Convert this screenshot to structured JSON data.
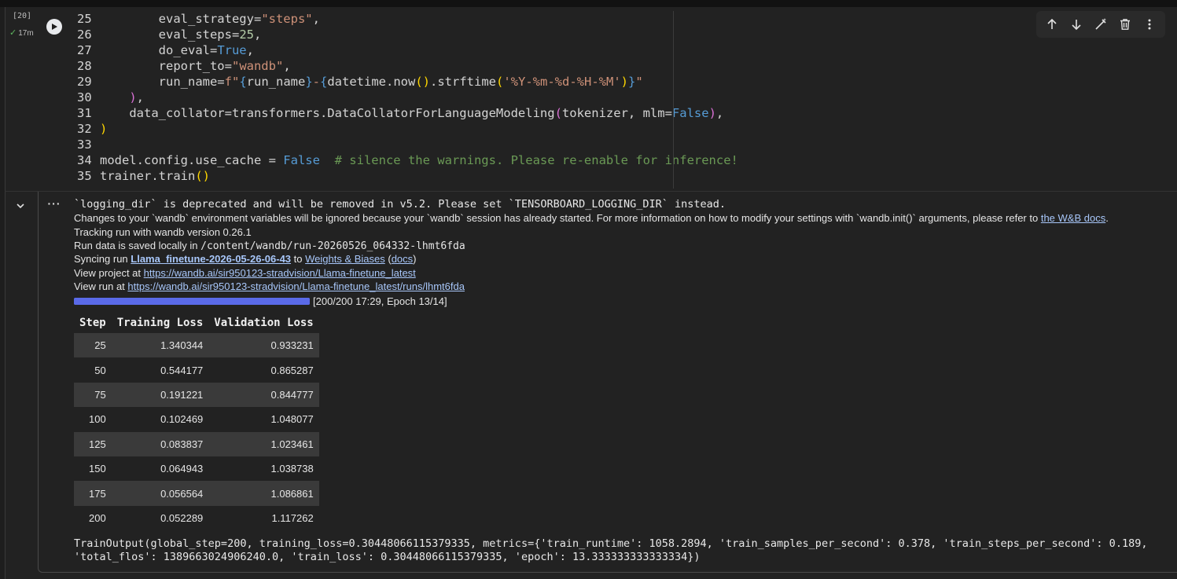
{
  "cell": {
    "exec_count": "[20]",
    "exec_time": "17m",
    "code_lines": [
      {
        "num": "25",
        "html": "        eval_strategy=<span class=\"s\">\"steps\"</span>,"
      },
      {
        "num": "26",
        "html": "        eval_steps=<span class=\"n\">25</span>,"
      },
      {
        "num": "27",
        "html": "        do_eval=<span class=\"k\">True</span>,"
      },
      {
        "num": "28",
        "html": "        report_to=<span class=\"s\">\"wandb\"</span>,"
      },
      {
        "num": "29",
        "html": "        run_name=<span class=\"s\">f\"</span><span class=\"k\">{</span>run_name<span class=\"k\">}</span><span class=\"s\">-</span><span class=\"k\">{</span>datetime.now<span class=\"p1\">()</span>.strftime<span class=\"p1\">(</span><span class=\"s\">'%Y-%m-%d-%H-%M'</span><span class=\"p1\">)</span><span class=\"k\">}</span><span class=\"s\">\"</span>"
      },
      {
        "num": "30",
        "html": "    <span class=\"p2\">)</span>,"
      },
      {
        "num": "31",
        "html": "    data_collator=transformers.DataCollatorForLanguageModeling<span class=\"p2\">(</span>tokenizer, mlm=<span class=\"k\">False</span><span class=\"p2\">)</span>,"
      },
      {
        "num": "32",
        "html": "<span class=\"p1\">)</span>"
      },
      {
        "num": "33",
        "html": ""
      },
      {
        "num": "34",
        "html": "model.config.use_cache = <span class=\"k\">False</span>  <span class=\"c\"># silence the warnings. Please re-enable for inference!</span>"
      },
      {
        "num": "35",
        "html": "trainer.train<span class=\"p1\">()</span>"
      }
    ]
  },
  "output": {
    "warning": "`logging_dir` is deprecated and will be removed in v5.2. Please set `TENSORBOARD_LOGGING_DIR` instead.",
    "env_notice": "Changes to your `wandb` environment variables will be ignored because your `wandb` session has already started. For more information on how to modify your settings with `wandb.init()` arguments, please refer to ",
    "env_link": "the W&B docs",
    "env_end": ".",
    "tracking": "Tracking run with wandb version 0.26.1",
    "run_saved_prefix": "Run data is saved locally in ",
    "run_saved_path": "/content/wandb/run-20260526_064332-lhmt6fda",
    "sync_prefix": "Syncing run ",
    "sync_run": "Llama_finetune-2026-05-26-06-43",
    "sync_to": " to ",
    "sync_wb": "Weights & Biases",
    "sync_open": " (",
    "sync_docs": "docs",
    "sync_close": ")",
    "project_prefix": "View project at ",
    "project_url": "https://wandb.ai/sir950123-stradvision/Llama-finetune_latest",
    "run_prefix": "View run at ",
    "run_url": "https://wandb.ai/sir950123-stradvision/Llama-finetune_latest/runs/lhmt6fda",
    "progress_fraction": 1.0,
    "progress_text": "[200/200 17:29, Epoch 13/14]",
    "table": {
      "headers": [
        "Step",
        "Training Loss",
        "Validation Loss"
      ],
      "rows": [
        [
          "25",
          "1.340344",
          "0.933231"
        ],
        [
          "50",
          "0.544177",
          "0.865287"
        ],
        [
          "75",
          "0.191221",
          "0.844777"
        ],
        [
          "100",
          "0.102469",
          "1.048077"
        ],
        [
          "125",
          "0.083837",
          "1.023461"
        ],
        [
          "150",
          "0.064943",
          "1.038738"
        ],
        [
          "175",
          "0.056564",
          "1.086861"
        ],
        [
          "200",
          "0.052289",
          "1.117262"
        ]
      ]
    },
    "train_output": "TrainOutput(global_step=200, training_loss=0.30448066115379335, metrics={'train_runtime': 1058.2894, 'train_samples_per_second': 0.378, 'train_steps_per_second': 0.189, 'total_flos': 1389663024906240.0, 'train_loss': 0.30448066115379335, 'epoch': 13.333333333333334})"
  },
  "toolbar": {
    "icons": [
      "arrow-up-icon",
      "arrow-down-icon",
      "edit-icon",
      "delete-icon",
      "more-vert-icon"
    ]
  }
}
